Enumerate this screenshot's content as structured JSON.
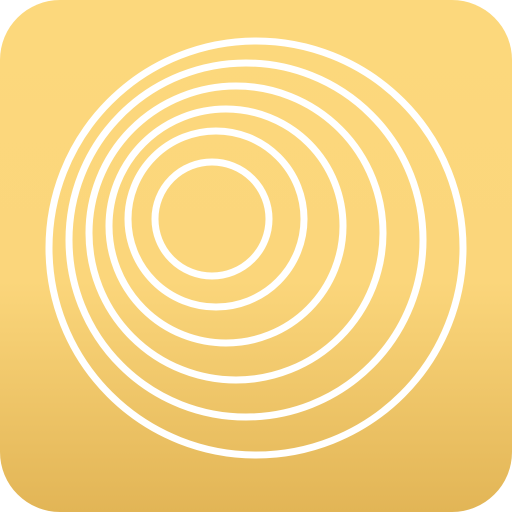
{
  "icon": {
    "name": "concentric-rings-icon",
    "colors": {
      "gradient_top": "#FCD87C",
      "gradient_mid": "#FBD67B",
      "gradient_bottom": "#E2B556",
      "ring_stroke": "#FFFFFF"
    },
    "ring_count": 6
  }
}
